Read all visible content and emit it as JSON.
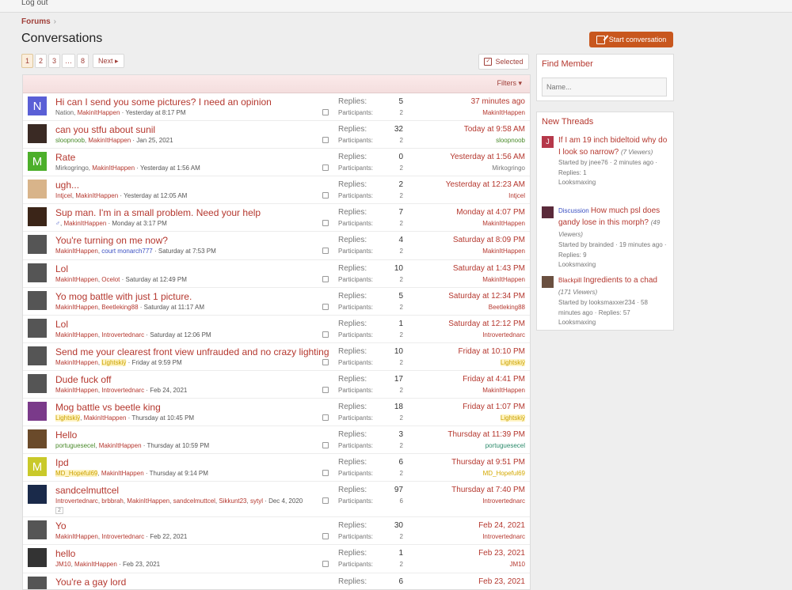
{
  "top": {
    "logout": "Log out"
  },
  "breadcrumb": {
    "forums": "Forums",
    "chevron": "›"
  },
  "page_title": "Conversations",
  "start_button": "Start conversation",
  "pager": {
    "pages": [
      "1",
      "2",
      "3",
      "…",
      "8"
    ],
    "next": "Next ▸"
  },
  "selected": "Selected",
  "filters": "Filters ▾",
  "labels": {
    "replies": "Replies:",
    "participants": "Participants:"
  },
  "rows": [
    {
      "title": "Hi can I send you some pictures? I need an opinion",
      "users": [
        {
          "n": "Nation, ",
          "c": "grey"
        },
        {
          "n": "MakinItHappen",
          "c": ""
        }
      ],
      "date": "Yesterday at 8:17 PM",
      "replies": "5",
      "participants": "2",
      "time": "37 minutes ago",
      "last": "MakinItHappen",
      "lastc": "",
      "av": "N",
      "avbg": "#5a5fd6"
    },
    {
      "title": "can you stfu about sunil",
      "users": [
        {
          "n": "sloopnoob",
          "c": "green"
        },
        {
          "n": ", ",
          "c": "grey"
        },
        {
          "n": "MakinItHappen",
          "c": ""
        }
      ],
      "date": "Jan 25, 2021",
      "replies": "32",
      "participants": "2",
      "time": "Today at 9:58 AM",
      "last": "sloopnoob",
      "lastc": "green",
      "av": "",
      "avbg": "#3a2a24"
    },
    {
      "title": "Rate",
      "users": [
        {
          "n": "Mirkogringo, ",
          "c": "grey"
        },
        {
          "n": "MakinItHappen",
          "c": ""
        }
      ],
      "date": "Yesterday at 1:56 AM",
      "replies": "0",
      "participants": "2",
      "time": "Yesterday at 1:56 AM",
      "last": "Mirkogringo",
      "lastc": "grey",
      "av": "M",
      "avbg": "#4caf2a"
    },
    {
      "title": "ugh...",
      "users": [
        {
          "n": "Intjcel",
          "c": ""
        },
        {
          "n": ", ",
          "c": "grey"
        },
        {
          "n": "MakinItHappen",
          "c": ""
        }
      ],
      "date": "Yesterday at 12:05 AM",
      "replies": "2",
      "participants": "2",
      "time": "Yesterday at 12:23 AM",
      "last": "Intjcel",
      "lastc": "",
      "av": "",
      "avbg": "#d8b48a"
    },
    {
      "title": "Sup man. I'm in a small problem. Need your help",
      "users": [
        {
          "n": "♂",
          "c": "blue"
        },
        {
          "n": ", ",
          "c": "grey"
        },
        {
          "n": "MakinItHappen",
          "c": ""
        }
      ],
      "date": "Monday at 3:17 PM",
      "replies": "7",
      "participants": "2",
      "time": "Monday at 4:07 PM",
      "last": "MakinItHappen",
      "lastc": "",
      "av": "",
      "avbg": "#3b2518"
    },
    {
      "title": "You're turning on me now?",
      "users": [
        {
          "n": "MakinItHappen",
          "c": ""
        },
        {
          "n": ", ",
          "c": "grey"
        },
        {
          "n": "court monarch777",
          "c": "blue"
        }
      ],
      "date": "Saturday at 7:53 PM",
      "replies": "4",
      "participants": "2",
      "time": "Saturday at 8:09 PM",
      "last": "MakinItHappen",
      "lastc": "",
      "av": "",
      "avbg": "#555"
    },
    {
      "title": "Lol",
      "users": [
        {
          "n": "MakinItHappen",
          "c": ""
        },
        {
          "n": ", ",
          "c": "grey"
        },
        {
          "n": "Ocelot",
          "c": ""
        }
      ],
      "date": "Saturday at 12:49 PM",
      "replies": "10",
      "participants": "2",
      "time": "Saturday at 1:43 PM",
      "last": "MakinItHappen",
      "lastc": "",
      "av": "",
      "avbg": "#555"
    },
    {
      "title": "Yo mog battle with just 1 picture.",
      "users": [
        {
          "n": "MakinItHappen",
          "c": ""
        },
        {
          "n": ", ",
          "c": "grey"
        },
        {
          "n": "Beetleking88",
          "c": ""
        }
      ],
      "date": "Saturday at 11:17 AM",
      "replies": "5",
      "participants": "2",
      "time": "Saturday at 12:34 PM",
      "last": "Beetleking88",
      "lastc": "",
      "av": "",
      "avbg": "#555"
    },
    {
      "title": "Lol",
      "users": [
        {
          "n": "MakinItHappen",
          "c": ""
        },
        {
          "n": ", ",
          "c": "grey"
        },
        {
          "n": "Introvertednarc",
          "c": ""
        }
      ],
      "date": "Saturday at 12:06 PM",
      "replies": "1",
      "participants": "2",
      "time": "Saturday at 12:12 PM",
      "last": "Introvertednarc",
      "lastc": "",
      "av": "",
      "avbg": "#555"
    },
    {
      "title": "Send me your clearest front view unfrauded and no crazy lighting",
      "users": [
        {
          "n": "MakinItHappen",
          "c": ""
        },
        {
          "n": ", ",
          "c": "grey"
        },
        {
          "n": "Lightskiÿ",
          "c": "gold"
        }
      ],
      "date": "Friday at 9:59 PM",
      "replies": "10",
      "participants": "2",
      "time": "Friday at 10:10 PM",
      "last": "Lightskiÿ",
      "lastc": "gold",
      "av": "",
      "avbg": "#555"
    },
    {
      "title": "Dude fuck off",
      "users": [
        {
          "n": "MakinItHappen",
          "c": ""
        },
        {
          "n": ", ",
          "c": "grey"
        },
        {
          "n": "Introvertednarc",
          "c": ""
        }
      ],
      "date": "Feb 24, 2021",
      "replies": "17",
      "participants": "2",
      "time": "Friday at 4:41 PM",
      "last": "MakinItHappen",
      "lastc": "",
      "av": "",
      "avbg": "#555"
    },
    {
      "title": "Mog battle vs beetle king",
      "users": [
        {
          "n": "Lightskiÿ",
          "c": "gold"
        },
        {
          "n": ", ",
          "c": "grey"
        },
        {
          "n": "MakinItHappen",
          "c": ""
        }
      ],
      "date": "Thursday at 10:45 PM",
      "replies": "18",
      "participants": "2",
      "time": "Friday at 1:07 PM",
      "last": "Lightskiÿ",
      "lastc": "gold",
      "av": "",
      "avbg": "#7a3a8a"
    },
    {
      "title": "Hello",
      "users": [
        {
          "n": "portuguesecel",
          "c": "green"
        },
        {
          "n": ", ",
          "c": "grey"
        },
        {
          "n": "MakinItHappen",
          "c": ""
        }
      ],
      "date": "Thursday at 10:59 PM",
      "replies": "3",
      "participants": "2",
      "time": "Thursday at 11:39 PM",
      "last": "portuguesecel",
      "lastc": "teal",
      "av": "",
      "avbg": "#6a4a2a"
    },
    {
      "title": "Ipd",
      "users": [
        {
          "n": "MD_Hopeful69",
          "c": "gold"
        },
        {
          "n": ", ",
          "c": "grey"
        },
        {
          "n": "MakinItHappen",
          "c": ""
        }
      ],
      "date": "Thursday at 9:14 PM",
      "replies": "6",
      "participants": "2",
      "time": "Thursday at 9:51 PM",
      "last": "MD_Hopeful69",
      "lastc": "mdgold",
      "av": "M",
      "avbg": "#c9c92a"
    },
    {
      "title": "sandcelmuttcel",
      "users": [
        {
          "n": "Introvertednarc",
          "c": ""
        },
        {
          "n": ", ",
          "c": "grey"
        },
        {
          "n": "brbbrah",
          "c": ""
        },
        {
          "n": ", ",
          "c": "grey"
        },
        {
          "n": "MakinItHappen",
          "c": ""
        },
        {
          "n": ", ",
          "c": "grey"
        },
        {
          "n": "sandcelmuttcel",
          "c": ""
        },
        {
          "n": ", ",
          "c": "grey"
        },
        {
          "n": "Sikkunt23",
          "c": ""
        },
        {
          "n": ", ",
          "c": "grey"
        },
        {
          "n": "sytyl",
          "c": ""
        }
      ],
      "date": "Dec 4, 2020",
      "badge": "2",
      "replies": "97",
      "participants": "6",
      "time": "Thursday at 7:40 PM",
      "last": "Introvertednarc",
      "lastc": "",
      "av": "",
      "avbg": "#1a2a4a",
      "tall": true
    },
    {
      "title": "Yo",
      "users": [
        {
          "n": "MakinItHappen",
          "c": ""
        },
        {
          "n": ", ",
          "c": "grey"
        },
        {
          "n": "Introvertednarc",
          "c": ""
        }
      ],
      "date": "Feb 22, 2021",
      "replies": "30",
      "participants": "2",
      "time": "Feb 24, 2021",
      "last": "Introvertednarc",
      "lastc": "",
      "av": "",
      "avbg": "#555"
    },
    {
      "title": "hello",
      "users": [
        {
          "n": "JM10",
          "c": ""
        },
        {
          "n": ", ",
          "c": "grey"
        },
        {
          "n": "MakinItHappen",
          "c": ""
        }
      ],
      "date": "Feb 23, 2021",
      "replies": "1",
      "participants": "2",
      "time": "Feb 23, 2021",
      "last": "JM10",
      "lastc": "",
      "av": "",
      "avbg": "#333"
    },
    {
      "title": "You're a gay lord",
      "users": [
        {
          "n": "MakinItHappen",
          "c": ""
        }
      ],
      "date": "",
      "replies": "6",
      "participants": "2",
      "time": "Feb 23, 2021",
      "last": "MakinItHappen",
      "lastc": "",
      "av": "",
      "avbg": "#555"
    }
  ],
  "find_member": {
    "title": "Find Member",
    "placeholder": "Name..."
  },
  "new_threads": {
    "title": "New Threads",
    "items": [
      {
        "prefix": "",
        "title": "If I am 19 inch bideltoid why do I look so narrow?",
        "views": "(7 Viewers)",
        "started": "Started by jnee76 · 2 minutes ago · Replies: 1",
        "forum": "Looksmaxing",
        "av": "J",
        "avbg": "#b5384a"
      },
      {
        "prefix": "Discussion",
        "title": "How much psl does gandy lose in this morph?",
        "views": "(49 Viewers)",
        "started": "Started by brainded · 19 minutes ago · Replies: 9",
        "forum": "Looksmaxing",
        "av": "",
        "avbg": "#5a2a3a"
      },
      {
        "prefix": "Blackpill",
        "title": "Ingredients to a chad",
        "views": "(171 Viewers)",
        "started": "Started by looksmaxxer234 · 58 minutes ago · Replies: 57",
        "forum": "Looksmaxing",
        "av": "",
        "avbg": "#6a5040"
      }
    ]
  }
}
